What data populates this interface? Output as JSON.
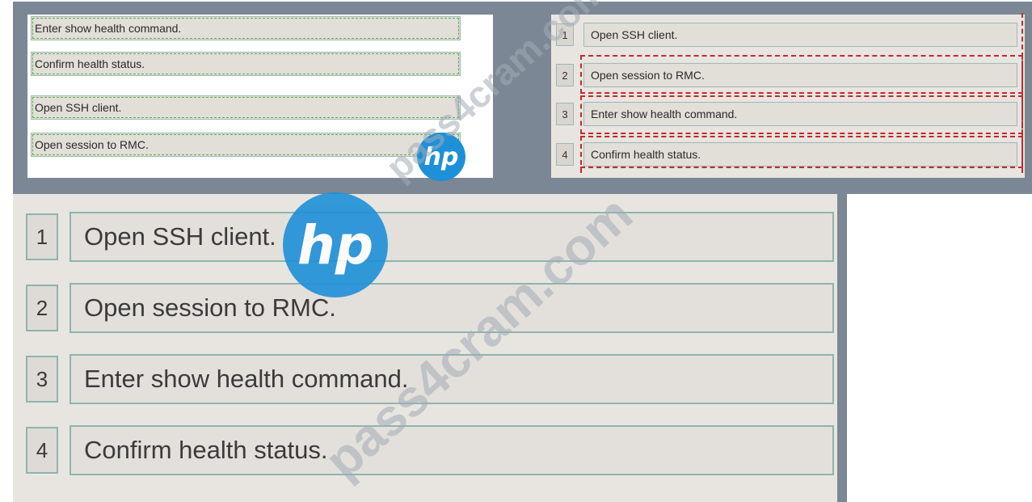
{
  "source_items": [
    {
      "label": "Enter show health command."
    },
    {
      "label": "Confirm health status."
    },
    {
      "label": "Open SSH client."
    },
    {
      "label": "Open session to RMC."
    }
  ],
  "answer_items": [
    {
      "number": "1",
      "label": "Open SSH client."
    },
    {
      "number": "2",
      "label": "Open session to RMC."
    },
    {
      "number": "3",
      "label": "Enter show health command."
    },
    {
      "number": "4",
      "label": "Confirm health status."
    }
  ],
  "zoomed_answer": [
    {
      "number": "1",
      "label": "Open SSH client."
    },
    {
      "number": "2",
      "label": "Open session to RMC."
    },
    {
      "number": "3",
      "label": "Enter show health command."
    },
    {
      "number": "4",
      "label": "Confirm health status."
    }
  ],
  "logo": {
    "text": "hp"
  },
  "watermark": {
    "text": "pass4cram.com"
  },
  "colors": {
    "frame": "#7b8794",
    "green_dash": "#58b04a",
    "red_dash": "#c32a2a",
    "hp_blue": "#1e90d8"
  }
}
